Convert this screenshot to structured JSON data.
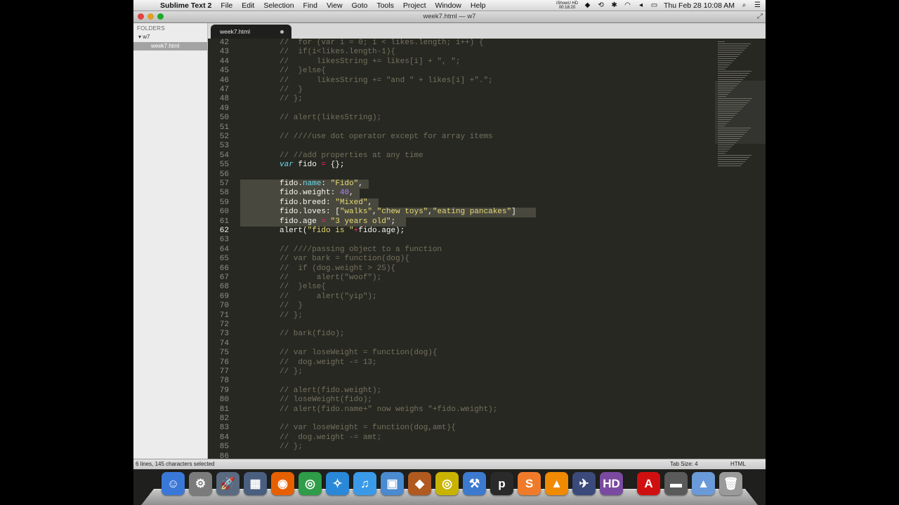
{
  "menubar": {
    "apple": "",
    "app_name": "Sublime Text 2",
    "items": [
      "File",
      "Edit",
      "Selection",
      "Find",
      "View",
      "Goto",
      "Tools",
      "Project",
      "Window",
      "Help"
    ],
    "ishowu_line1": "iShowU HD",
    "ishowu_line2": "00:18:20",
    "clock": "Thu Feb 28  10:08 AM"
  },
  "window": {
    "title": "week7.html — w7"
  },
  "sidebar": {
    "header": "FOLDERS",
    "folder": "w7",
    "file": "week7.html"
  },
  "tab": {
    "label": "week7.html"
  },
  "editor": {
    "lines": [
      {
        "n": "42",
        "html": "<span class='cmt'>//  for (var i = 0; i &lt; likes.length; i++) {</span>"
      },
      {
        "n": "43",
        "html": "<span class='cmt'>//  if(i&lt;likes.length-1){</span>"
      },
      {
        "n": "44",
        "html": "<span class='cmt'>//      likesString += likes[i] + \", \";</span>"
      },
      {
        "n": "45",
        "html": "<span class='cmt'>//  }else{</span>"
      },
      {
        "n": "46",
        "html": "<span class='cmt'>//      likesString += \"and \" + likes[i] +\".\";</span>"
      },
      {
        "n": "47",
        "html": "<span class='cmt'>//  }</span>"
      },
      {
        "n": "48",
        "html": "<span class='cmt'>// };</span>"
      },
      {
        "n": "49",
        "html": ""
      },
      {
        "n": "50",
        "html": "<span class='cmt'>// alert(likesString);</span>"
      },
      {
        "n": "51",
        "html": ""
      },
      {
        "n": "52",
        "html": "<span class='cmt'>// ////use dot operator except for array items</span>"
      },
      {
        "n": "53",
        "html": ""
      },
      {
        "n": "54",
        "html": "<span class='cmt'>// //add properties at any time</span>"
      },
      {
        "n": "55",
        "html": "<span class='kw'>var</span> fido <span class='op'>=</span> {};"
      },
      {
        "n": "56",
        "html": ""
      },
      {
        "n": "57",
        "html": "fido.<span class='prop'>name</span>: <span class='str'>\"Fido\"</span>,",
        "sel": 183
      },
      {
        "n": "58",
        "html": "fido.weight: <span class='num'>40</span>,",
        "sel": 170
      },
      {
        "n": "59",
        "html": "fido.breed: <span class='str'>\"Mixed\"</span>,",
        "sel": 197
      },
      {
        "n": "60",
        "html": "fido.loves: [<span class='str'>\"walks\"</span>,<span class='str'>\"chew toys\"</span>,<span class='str'>\"eating pancakes\"</span>]",
        "sel": 421
      },
      {
        "n": "61",
        "html": "fido.age <span class='op'>=</span> <span class='str'>\"3 years old\"</span>;",
        "sel": 236
      },
      {
        "n": "62",
        "html": "alert(<span class='str'>\"fido is \"</span><span class='op'>+</span>fido.age);",
        "current": true
      },
      {
        "n": "63",
        "html": ""
      },
      {
        "n": "64",
        "html": "<span class='cmt'>// ////passing object to a function</span>"
      },
      {
        "n": "65",
        "html": "<span class='cmt'>// var bark = function(dog){</span>"
      },
      {
        "n": "66",
        "html": "<span class='cmt'>//  if (dog.weight &gt; 25){</span>"
      },
      {
        "n": "67",
        "html": "<span class='cmt'>//      alert(\"woof\");</span>"
      },
      {
        "n": "68",
        "html": "<span class='cmt'>//  }else{</span>"
      },
      {
        "n": "69",
        "html": "<span class='cmt'>//      alert(\"yip\");</span>"
      },
      {
        "n": "70",
        "html": "<span class='cmt'>//  }</span>"
      },
      {
        "n": "71",
        "html": "<span class='cmt'>// };</span>"
      },
      {
        "n": "72",
        "html": ""
      },
      {
        "n": "73",
        "html": "<span class='cmt'>// bark(fido);</span>"
      },
      {
        "n": "74",
        "html": ""
      },
      {
        "n": "75",
        "html": "<span class='cmt'>// var loseWeight = function(dog){</span>"
      },
      {
        "n": "76",
        "html": "<span class='cmt'>//  dog.weight -= 13;</span>"
      },
      {
        "n": "77",
        "html": "<span class='cmt'>// };</span>"
      },
      {
        "n": "78",
        "html": ""
      },
      {
        "n": "79",
        "html": "<span class='cmt'>// alert(fido.weight);</span>"
      },
      {
        "n": "80",
        "html": "<span class='cmt'>// loseWeight(fido);</span>"
      },
      {
        "n": "81",
        "html": "<span class='cmt'>// alert(fido.name+\" now weighs \"+fido.weight);</span>"
      },
      {
        "n": "82",
        "html": ""
      },
      {
        "n": "83",
        "html": "<span class='cmt'>// var loseWeight = function(dog,amt){</span>"
      },
      {
        "n": "84",
        "html": "<span class='cmt'>//  dog.weight -= amt;</span>"
      },
      {
        "n": "85",
        "html": "<span class='cmt'>// };</span>"
      },
      {
        "n": "86",
        "html": ""
      }
    ]
  },
  "statusbar": {
    "selection": "6 lines, 145 characters selected",
    "tab_size": "Tab Size: 4",
    "syntax": "HTML"
  },
  "dock": {
    "icons": [
      {
        "name": "finder-icon",
        "glyph": "☺",
        "color": "#3a78d8"
      },
      {
        "name": "system-preferences-icon",
        "glyph": "⚙",
        "color": "#7b7b7b"
      },
      {
        "name": "launchpad-icon",
        "glyph": "🚀",
        "color": "#5a6a80"
      },
      {
        "name": "mission-control-icon",
        "glyph": "▦",
        "color": "#4a5e80"
      },
      {
        "name": "firefox-icon",
        "glyph": "◉",
        "color": "#e66000"
      },
      {
        "name": "chrome-icon",
        "glyph": "◎",
        "color": "#2e9c48"
      },
      {
        "name": "safari-icon",
        "glyph": "✧",
        "color": "#2a88d8"
      },
      {
        "name": "itunes-icon",
        "glyph": "♫",
        "color": "#3a9ae8"
      },
      {
        "name": "photo-icon",
        "glyph": "▣",
        "color": "#4a8ad0"
      },
      {
        "name": "transmit-icon",
        "glyph": "◆",
        "color": "#b05a20"
      },
      {
        "name": "target-icon",
        "glyph": "◎",
        "color": "#c8b400"
      },
      {
        "name": "xcode-icon",
        "glyph": "⚒",
        "color": "#3c7ad0"
      },
      {
        "name": "pixelmator-icon",
        "glyph": "p",
        "color": "#2a2a2a"
      },
      {
        "name": "sublime-text-icon",
        "glyph": "S",
        "color": "#ef7b2a"
      },
      {
        "name": "vlc-icon",
        "glyph": "▲",
        "color": "#f08a00"
      },
      {
        "name": "plane-icon",
        "glyph": "✈",
        "color": "#3a4a7a"
      },
      {
        "name": "hd-icon",
        "glyph": "HD",
        "color": "#7a4aa0"
      },
      {
        "name": "adobe-icon",
        "glyph": "A",
        "color": "#d01010"
      },
      {
        "name": "folder-icon",
        "glyph": "▬",
        "color": "#5a5a5a"
      },
      {
        "name": "applications-icon",
        "glyph": "▲",
        "color": "#6a9ad8"
      },
      {
        "name": "trash-icon",
        "glyph": "🗑",
        "color": "#9a9a9a"
      }
    ]
  },
  "colors": {
    "editor_bg": "#272822",
    "comment": "#75715e",
    "string": "#e6db74",
    "number": "#ae81ff",
    "keyword": "#66d9ef",
    "operator": "#f92672"
  }
}
